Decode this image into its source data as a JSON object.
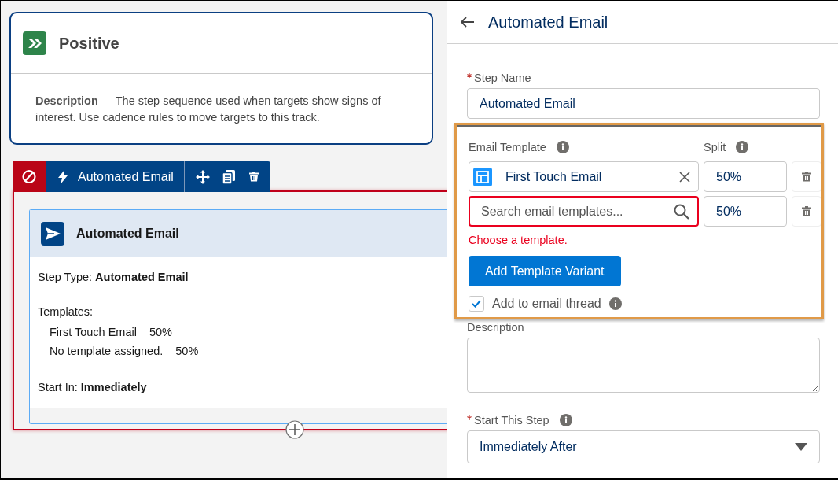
{
  "track": {
    "title": "Positive",
    "description_label": "Description",
    "description": "The step sequence used when targets show signs of interest. Use cadence rules to move targets to this track."
  },
  "step_toolbar": {
    "label": "Automated Email",
    "error": true
  },
  "step_card": {
    "title": "Automated Email",
    "step_type": "Step Type: **Automated Email**",
    "templates_label": "Templates:",
    "templates": [
      {
        "name": "First Touch Email",
        "split": "50%"
      },
      {
        "name": "No template assigned.",
        "split": "50%"
      }
    ],
    "start_in": "Start In: **Immediately**"
  },
  "panel": {
    "title": "Automated Email",
    "step_name": {
      "label": "Step Name",
      "required": true,
      "value": "Automated Email"
    },
    "email_templates": {
      "label": "Email Template",
      "split_label": "Split",
      "highlighted": true,
      "rows": [
        {
          "kind": "selected",
          "value": "First Touch Email",
          "split": "50%",
          "error": false
        },
        {
          "kind": "search",
          "placeholder": "Search email templates...",
          "split": "50%",
          "error": true
        }
      ],
      "error_message": "Choose a template.",
      "add_button": "Add Template Variant",
      "thread": {
        "label": "Add to email thread",
        "checked": true
      }
    },
    "description": {
      "label": "Description"
    },
    "start_step": {
      "label": "Start This Step",
      "required": true,
      "value": "Immediately After"
    }
  }
}
